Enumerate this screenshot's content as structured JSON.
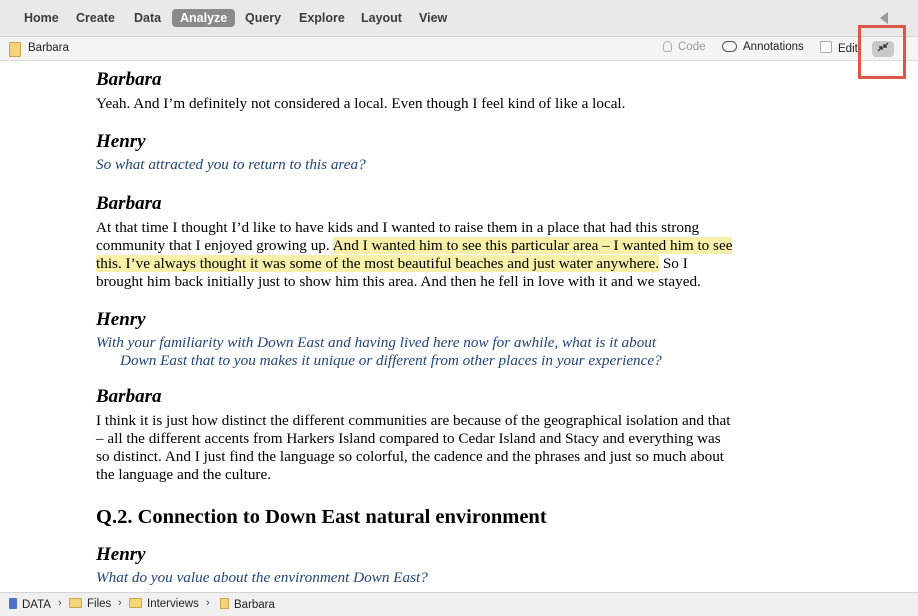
{
  "menu": {
    "items": [
      {
        "label": "Home"
      },
      {
        "label": "Create"
      },
      {
        "label": "Data"
      },
      {
        "label": "Analyze"
      },
      {
        "label": "Query"
      },
      {
        "label": "Explore"
      },
      {
        "label": "Layout"
      },
      {
        "label": "View"
      }
    ],
    "active": "Analyze"
  },
  "docbar": {
    "title": "Barbara",
    "code_label": "Code",
    "annotations_label": "Annotations",
    "edit_label": "Edit"
  },
  "transcript": {
    "b1_speaker": "Barbara",
    "b1_text": "Yeah. And I’m definitely not considered a local. Even though I feel kind of like a local.",
    "h1_speaker": "Henry",
    "h1_question": "So what attracted you to return to this area?",
    "b2_speaker": "Barbara",
    "b2_text_before": "At that time I thought I’d like to have kids and I wanted to raise them in a place that had this strong community that I enjoyed growing up. ",
    "b2_text_highlight": "And I wanted him to see this particular area – I wanted him to see this. I’ve always thought it was some of the most beautiful beaches and just water anywhere.",
    "b2_text_after": " So I brought him back initially just to show him this area. And then he fell in love with it and we stayed.",
    "h2_speaker": "Henry",
    "h2_question_line1": "With your familiarity with Down East and having lived here now for awhile, what is it about",
    "h2_question_line2": "Down East that to you makes it unique or different from other places in your experience?",
    "b3_speaker": "Barbara",
    "b3_text": "I think it is just how distinct the different communities are because of the geographical isolation and that – all the different accents from Harkers Island compared to Cedar Island and Stacy and everything was so distinct. And I just find the language so colorful, the cadence and the phrases and just so much about the language and the culture.",
    "section_heading": "Q.2. Connection to Down East natural environment",
    "h3_speaker": "Henry",
    "h3_question": "What do you value about the environment Down East?"
  },
  "statusbar": {
    "crumbs": [
      "DATA",
      "Files",
      "Interviews",
      "Barbara"
    ]
  },
  "colors": {
    "highlight": "#f7f0a8",
    "question_text": "#22457a",
    "callout": "#e0574a",
    "active_tab": "#8a8a8a"
  },
  "icons": {
    "doc": "document-icon",
    "code": "lightbulb-icon",
    "annotations": "speech-bubble-icon",
    "collapse": "collapse-arrows-icon",
    "breadcrumb_sep": "chevron-right-icon"
  }
}
